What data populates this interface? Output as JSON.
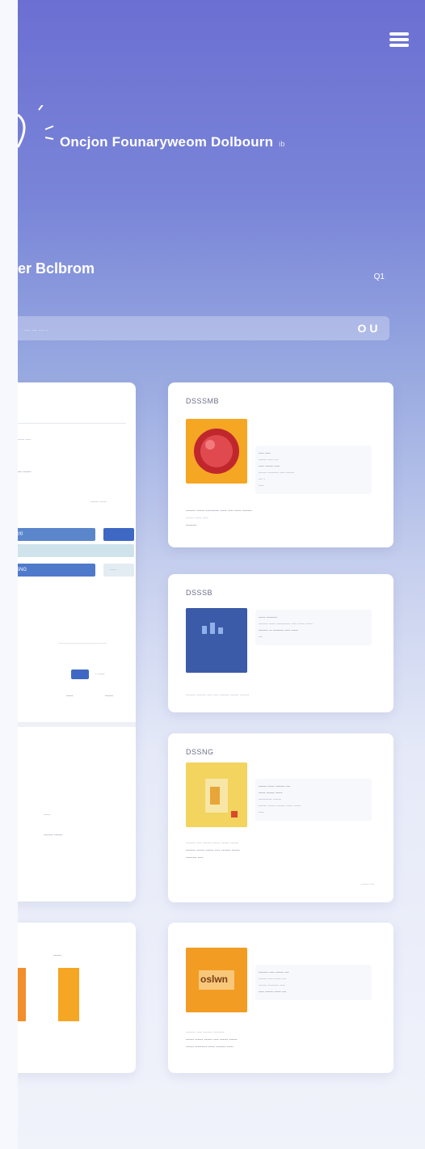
{
  "header": {
    "app_title": "Oncjon Founaryweom Dolbourn",
    "app_title_suffix": "ib"
  },
  "section": {
    "title": "er Bclbrom",
    "count": "Q1"
  },
  "search": {
    "placeholder": "... ... ... .",
    "button_label": "O U"
  },
  "left_card_1": {
    "label_a": "----- ----",
    "label_b": "--- ------",
    "label_c": "------ -----",
    "bar_1_label": "2/0",
    "bar_2_label": "SNG",
    "bar_3_label": "----",
    "row_label": "- -----",
    "col_a": "-----",
    "col_b": "------",
    "footer_1": "-----",
    "footer_2": "------- ------",
    "colors": {
      "bar_blue": "#3f68c4",
      "bar_light": "#cfe3ec"
    }
  },
  "left_card_2": {
    "label": "------",
    "colors": {
      "bar_orange": "#f28e2b",
      "bar_amber": "#f5a623"
    }
  },
  "cards": [
    {
      "title": "DSSSMB",
      "thumb_icon": "red-orb-image",
      "meta": [
        "---- ----",
        "------ ---- ---",
        "---- ------ ----",
        "------ -------- ---- ------",
        "--- -",
        "----"
      ],
      "desc": [
        "------- ------ ---------- ----- ---- ----- -------",
        "------ ----- ----",
        "--------"
      ]
    },
    {
      "title": "DSSSB",
      "thumb_icon": "blue-chart-image",
      "meta": [
        "----- --------",
        "------- ----- ---------- ---- ----- -----",
        "------- -- -------- ---- -----",
        "---"
      ],
      "desc": [
        "------- ------- ---- ---- ------- ------ -------"
      ]
    },
    {
      "title": "DSSNG",
      "thumb_icon": "yellow-document-image",
      "meta": [
        "------ ----- ------- ---",
        "----- ------ -----",
        "---------- ------",
        "------ ------ ------ ----- -----",
        "----"
      ],
      "desc": [
        "------- ---- ------ ------ ------ ------",
        "------- ------ ------ ---- ------- ------",
        "-------- ----"
      ],
      "link": "------ ---"
    },
    {
      "title": "",
      "thumb_icon": "orange-label-image",
      "thumb_text": "oslwn",
      "meta": [
        "------- ---- ------ ---",
        "------ ---- ----- ---",
        "------ -------- ----",
        "---- ------ ----- ---"
      ],
      "desc": [
        "------- ---- ------- --------",
        "------ ------ ------ ---- ------ ------",
        "------ --------- ----- ------- -----"
      ]
    }
  ],
  "colors": {
    "gradient_top": "#6b6fd2",
    "gradient_mid": "#97a8e0",
    "gradient_bottom": "#f1f3fb"
  }
}
